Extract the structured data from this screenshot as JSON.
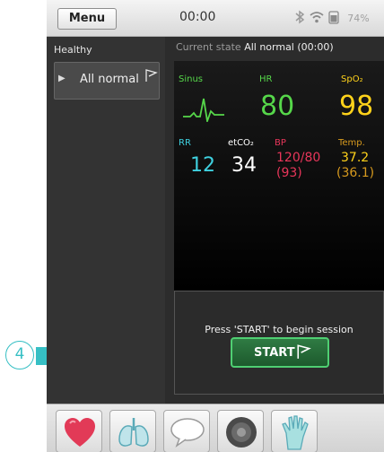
{
  "statusbar": {
    "menu_label": "Menu",
    "clock": "00:00",
    "battery": "74%",
    "icons": [
      "bluetooth-icon",
      "wifi-icon",
      "battery-icon"
    ]
  },
  "left_panel": {
    "title": "Healthy",
    "items": [
      {
        "label": "All normal",
        "icon": "flag-icon",
        "expand_icon": "triangle-right-icon"
      }
    ]
  },
  "current_state": {
    "prefix": "Current state",
    "value": "All normal (00:00)"
  },
  "monitor": {
    "sinus_label": "Sinus",
    "hr_label": "HR",
    "hr_value": "80",
    "spo2_label": "SpO₂",
    "spo2_value": "98",
    "rr_label": "RR",
    "rr_value": "12",
    "etco2_label": "etCO₂",
    "etco2_value": "34",
    "bp_label": "BP",
    "bp_value": "120/80",
    "bp_mean": "(93)",
    "temp_label": "Temp.",
    "temp_value": "37.2",
    "temp_secondary": "(36.1)",
    "colors": {
      "green": "#56d74a",
      "yellow": "#ffd21a",
      "cyan": "#3fd1e0",
      "red": "#e8365a",
      "orange": "#d79a1e"
    }
  },
  "session": {
    "prompt": "Press 'START' to begin session",
    "start_label": "START"
  },
  "toolbar": {
    "items": [
      "heart-icon",
      "lungs-icon",
      "speech-bubble-icon",
      "speaker-icon",
      "glove-icon"
    ]
  },
  "annotation": {
    "step_number": "4",
    "accent": "#36bfc4"
  }
}
